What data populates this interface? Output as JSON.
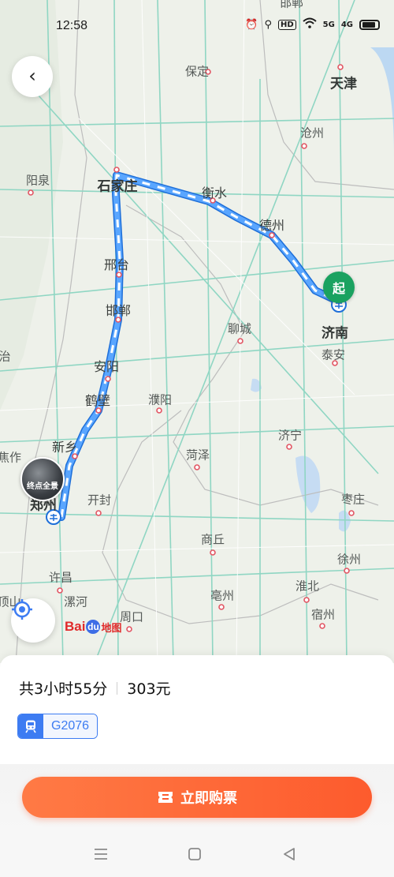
{
  "status_bar": {
    "time": "12:58",
    "icons": [
      "alarm-icon",
      "location-icon",
      "hd-icon",
      "wifi-icon",
      "5g-signal-icon",
      "4g-signal-icon",
      "battery-icon"
    ],
    "hd_label": "HD",
    "sig1": "5G",
    "sig2": "4G"
  },
  "map": {
    "cities": [
      {
        "name": "邯郸",
        "id": "handan"
      },
      {
        "name": "保定"
      },
      {
        "name": "天津"
      },
      {
        "name": "沧州"
      },
      {
        "name": "阳泉"
      },
      {
        "name": "石家庄"
      },
      {
        "name": "衡水"
      },
      {
        "name": "德州"
      },
      {
        "name": "邢台"
      },
      {
        "name": "邯郸"
      },
      {
        "name": "聊城"
      },
      {
        "name": "济南"
      },
      {
        "name": "泰安"
      },
      {
        "name": "安阳"
      },
      {
        "name": "鹤壁"
      },
      {
        "name": "濮阳"
      },
      {
        "name": "新乡"
      },
      {
        "name": "焦作"
      },
      {
        "name": "郑州"
      },
      {
        "name": "开封"
      },
      {
        "name": "菏泽"
      },
      {
        "name": "济宁"
      },
      {
        "name": "枣庄"
      },
      {
        "name": "商丘"
      },
      {
        "name": "许昌"
      },
      {
        "name": "淮北"
      },
      {
        "name": "徐州"
      },
      {
        "name": "亳州"
      },
      {
        "name": "宿州"
      },
      {
        "name": "漯河"
      },
      {
        "name": "周口"
      },
      {
        "name": "平顶山"
      },
      {
        "name": "治"
      },
      {
        "name": "邯郸"
      }
    ],
    "start_label": "起",
    "end_panorama_label": "终点全景",
    "logo": {
      "bai": "Bai",
      "du": "du",
      "map": "地图"
    },
    "route_color": "#3b8df5"
  },
  "trip": {
    "duration": "共3小时55分",
    "price": "303元",
    "train_number": "G2076"
  },
  "action": {
    "buy_label": "立即购票"
  },
  "nav": [
    "menu-icon",
    "home-icon",
    "back-icon"
  ]
}
